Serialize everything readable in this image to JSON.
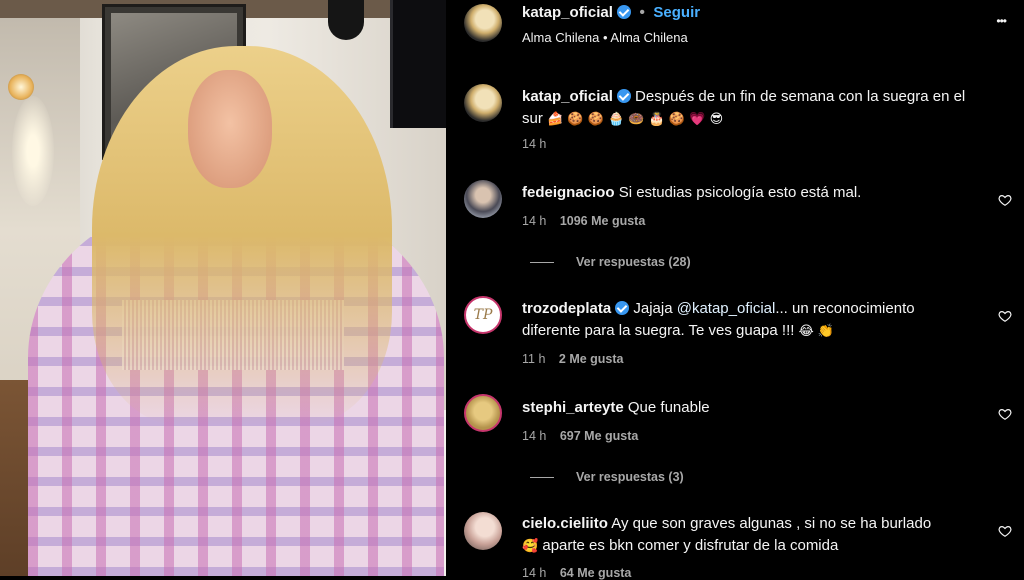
{
  "header": {
    "username": "katap_oficial",
    "follow_label": "Seguir",
    "audio_left": "Alma Chilena",
    "separator": "•",
    "audio_right": "Alma Chilena",
    "more_label": "•••"
  },
  "caption": {
    "username": "katap_oficial",
    "text": "Después de un fin de semana con la suegra en el",
    "text_line2": "sur",
    "emojis": "🍰 🍪 🍪 🧁 🍩 🎂 🍪 💗 😎",
    "time": "14 h"
  },
  "comments": [
    {
      "username": "fedeignacioo",
      "text": "Si estudias psicología esto está mal.",
      "time": "14 h",
      "likes": "1096 Me gusta",
      "replies": "Ver respuestas (28)"
    },
    {
      "username": "trozodeplata",
      "text_pre": "Jajaja ",
      "mention": "@katap_oficial",
      "text_post": "... un reconocimiento",
      "text_line2": "diferente para la suegra. Te ves guapa !!! ",
      "emojis": "😂 👏",
      "avatar_text": "TP",
      "time": "11 h",
      "likes": "2 Me gusta"
    },
    {
      "username": "stephi_arteyte",
      "text": "Que funable",
      "time": "14 h",
      "likes": "697 Me gusta",
      "replies": "Ver respuestas (3)"
    },
    {
      "username": "cielo.cieliito",
      "text": "Ay que son graves algunas , si no se ha burlado",
      "emoji": "🥰",
      "text_line2": " aparte es bkn comer y disfrutar de la comida",
      "time": "14 h",
      "likes": "64 Me gusta"
    }
  ],
  "colors": {
    "verified": "#3897f0",
    "follow": "#3897f0",
    "background": "#000000",
    "meta": "#a8a8a8"
  }
}
